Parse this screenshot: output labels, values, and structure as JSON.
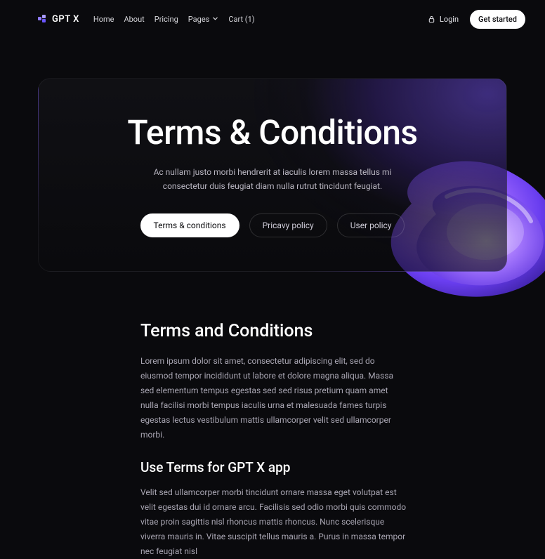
{
  "brand": {
    "name": "GPT X"
  },
  "nav": {
    "links": [
      "Home",
      "About",
      "Pricing",
      "Pages"
    ],
    "cart": "Cart (1)",
    "login": "Login",
    "cta": "Get started"
  },
  "hero": {
    "title": "Terms & Conditions",
    "subtitle": "Ac nullam justo morbi hendrerit at iaculis lorem massa tellus mi consectetur duis feugiat diam nulla rutrut tincidunt feugiat.",
    "tabs": [
      "Terms & conditions",
      "Pricavy policy",
      "User policy"
    ]
  },
  "body": {
    "h2": "Terms and Conditions",
    "p1": "Lorem ipsum dolor sit amet, consectetur adipiscing elit, sed do eiusmod tempor incididunt ut labore et dolore magna aliqua. Massa sed elementum tempus egestas sed sed risus pretium quam amet nulla facilisi morbi tempus iaculis urna et malesuada fames turpis egestas lectus vestibulum mattis ullamcorper velit sed ullamcorper morbi.",
    "h3": "Use Terms for GPT X app",
    "p2": "Velit sed ullamcorper morbi tincidunt ornare massa eget volutpat est velit egestas dui id ornare arcu. Facilisis sed odio morbi quis commodo vitae proin sagittis nisl rhoncus mattis rhoncus. Nunc scelerisque viverra mauris in. Vitae suscipit tellus mauris a. Purus in massa tempor nec feugiat nisl"
  }
}
